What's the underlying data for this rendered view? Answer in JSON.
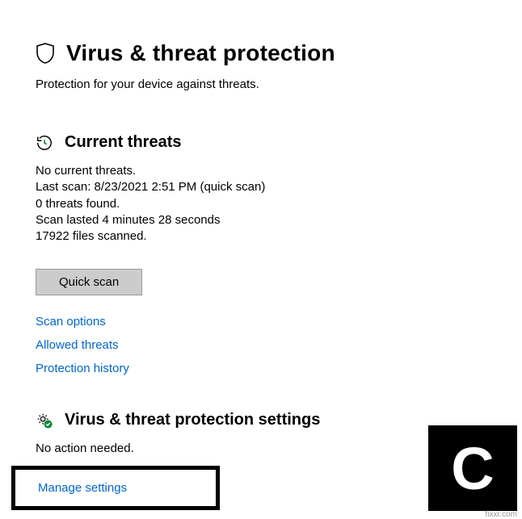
{
  "header": {
    "title": "Virus & threat protection",
    "subtitle": "Protection for your device against threats."
  },
  "currentThreats": {
    "sectionTitle": "Current threats",
    "noThreats": "No current threats.",
    "lastScan": "Last scan: 8/23/2021 2:51 PM (quick scan)",
    "threatsFound": "0 threats found.",
    "scanDuration": "Scan lasted 4 minutes 28 seconds",
    "filesScanned": "17922 files scanned.",
    "quickScanLabel": "Quick scan",
    "scanOptionsLabel": "Scan options",
    "allowedThreatsLabel": "Allowed threats",
    "protectionHistoryLabel": "Protection history"
  },
  "protectionSettings": {
    "sectionTitle": "Virus & threat protection settings",
    "status": "No action needed.",
    "manageLabel": "Manage settings"
  },
  "watermark": "fixxr.com"
}
